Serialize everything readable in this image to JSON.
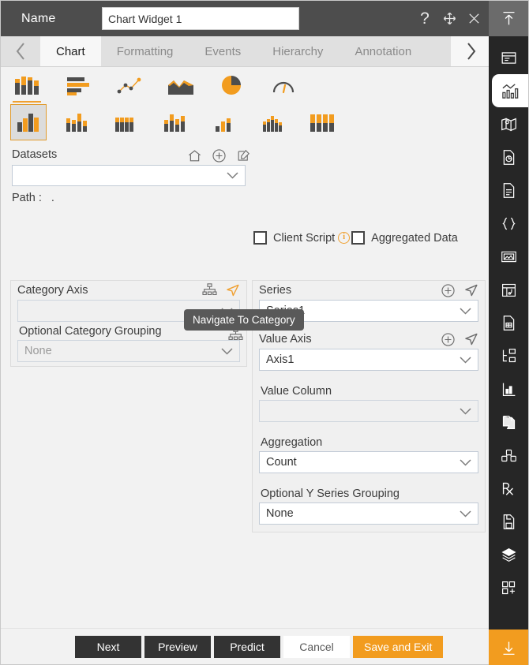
{
  "window": {
    "name_label": "Name",
    "widget_name": "Chart Widget 1",
    "name_placeholder": "Chart Widget 1",
    "help_icon": "?",
    "move_icon": "move-icon",
    "close_icon": "close-icon"
  },
  "tabs": {
    "prev_label": "‹",
    "next_label": "›",
    "items": [
      {
        "label": "Chart",
        "active": true
      },
      {
        "label": "Formatting",
        "active": false
      },
      {
        "label": "Events",
        "active": false
      },
      {
        "label": "Hierarchy",
        "active": false
      },
      {
        "label": "Annotation",
        "active": false
      }
    ]
  },
  "chart_types_row1": [
    {
      "name": "column-chart-icon",
      "selected": true
    },
    {
      "name": "bar-chart-icon",
      "selected": false
    },
    {
      "name": "scatter-line-chart-icon",
      "selected": false
    },
    {
      "name": "area-chart-icon",
      "selected": false
    },
    {
      "name": "pie-chart-icon",
      "selected": false
    },
    {
      "name": "gauge-chart-icon",
      "selected": false
    }
  ],
  "chart_types_row2": [
    {
      "name": "clustered-column-icon",
      "selected": true
    },
    {
      "name": "stacked-column-icon",
      "selected": false
    },
    {
      "name": "stacked-column-100-icon",
      "selected": false
    },
    {
      "name": "clustered-stacked-column-icon",
      "selected": false
    },
    {
      "name": "column-small-icon",
      "selected": false
    },
    {
      "name": "column-grouped-icon",
      "selected": false
    },
    {
      "name": "full-stacked-column-icon",
      "selected": false
    }
  ],
  "datasets": {
    "label": "Datasets",
    "home_icon": "home-icon",
    "add_icon": "plus-circle-icon",
    "edit_icon": "edit-pencil-icon",
    "selected_value": "",
    "path_label": "Path :",
    "path_value": "."
  },
  "options": {
    "client_script_label": "Client Script",
    "client_script_checked": false,
    "info_icon": "info-icon",
    "aggregated_data_label": "Aggregated Data",
    "aggregated_data_checked": false
  },
  "category_axis": {
    "title": "Category Axis",
    "hierarchy_icon": "hierarchy-icon",
    "navigate_icon": "navigate-arrow-icon",
    "value": "",
    "grouping_label": "Optional Category Grouping",
    "grouping_value": "None"
  },
  "series": {
    "title": "Series",
    "add_icon": "plus-circle-icon",
    "navigate_icon": "navigate-arrow-icon",
    "value": "Series1",
    "value_axis_label": "Value Axis",
    "value_axis_add_icon": "plus-circle-icon",
    "value_axis_navigate_icon": "navigate-arrow-icon",
    "value_axis_value": "Axis1",
    "value_column_label": "Value Column",
    "value_column_value": "",
    "aggregation_label": "Aggregation",
    "aggregation_value": "Count",
    "y_grouping_label": "Optional Y Series Grouping",
    "y_grouping_value": "None"
  },
  "tooltip": {
    "text": "Navigate To Category"
  },
  "footer": {
    "next": "Next",
    "preview": "Preview",
    "predict": "Predict",
    "cancel": "Cancel",
    "save_and_exit": "Save and Exit"
  },
  "rail": {
    "top_icon": "collapse-up-icon",
    "bottom_icon": "expand-down-icon",
    "items": [
      {
        "name": "form-widget-icon",
        "active": false
      },
      {
        "name": "chart-widget-icon",
        "active": true
      },
      {
        "name": "map-widget-icon",
        "active": false
      },
      {
        "name": "report-chart-icon",
        "active": false
      },
      {
        "name": "document-icon",
        "active": false
      },
      {
        "name": "json-braces-icon",
        "active": false
      },
      {
        "name": "image-gallery-icon",
        "active": false
      },
      {
        "name": "calendar-widget-icon",
        "active": false
      },
      {
        "name": "file-doc-icon",
        "active": false
      },
      {
        "name": "tree-hierarchy-icon",
        "active": false
      },
      {
        "name": "bar-graph-icon",
        "active": false
      },
      {
        "name": "copy-page-icon",
        "active": false
      },
      {
        "name": "blocks-cube-icon",
        "active": false
      },
      {
        "name": "prescription-rx-icon",
        "active": false
      },
      {
        "name": "save-document-icon",
        "active": false
      },
      {
        "name": "layers-icon",
        "active": false
      },
      {
        "name": "add-widget-icon",
        "active": false
      }
    ]
  },
  "colors": {
    "accent": "#f29c1f",
    "titlebar": "#4d4d4d",
    "rail": "#262626",
    "panel": "#f2f2f2"
  }
}
